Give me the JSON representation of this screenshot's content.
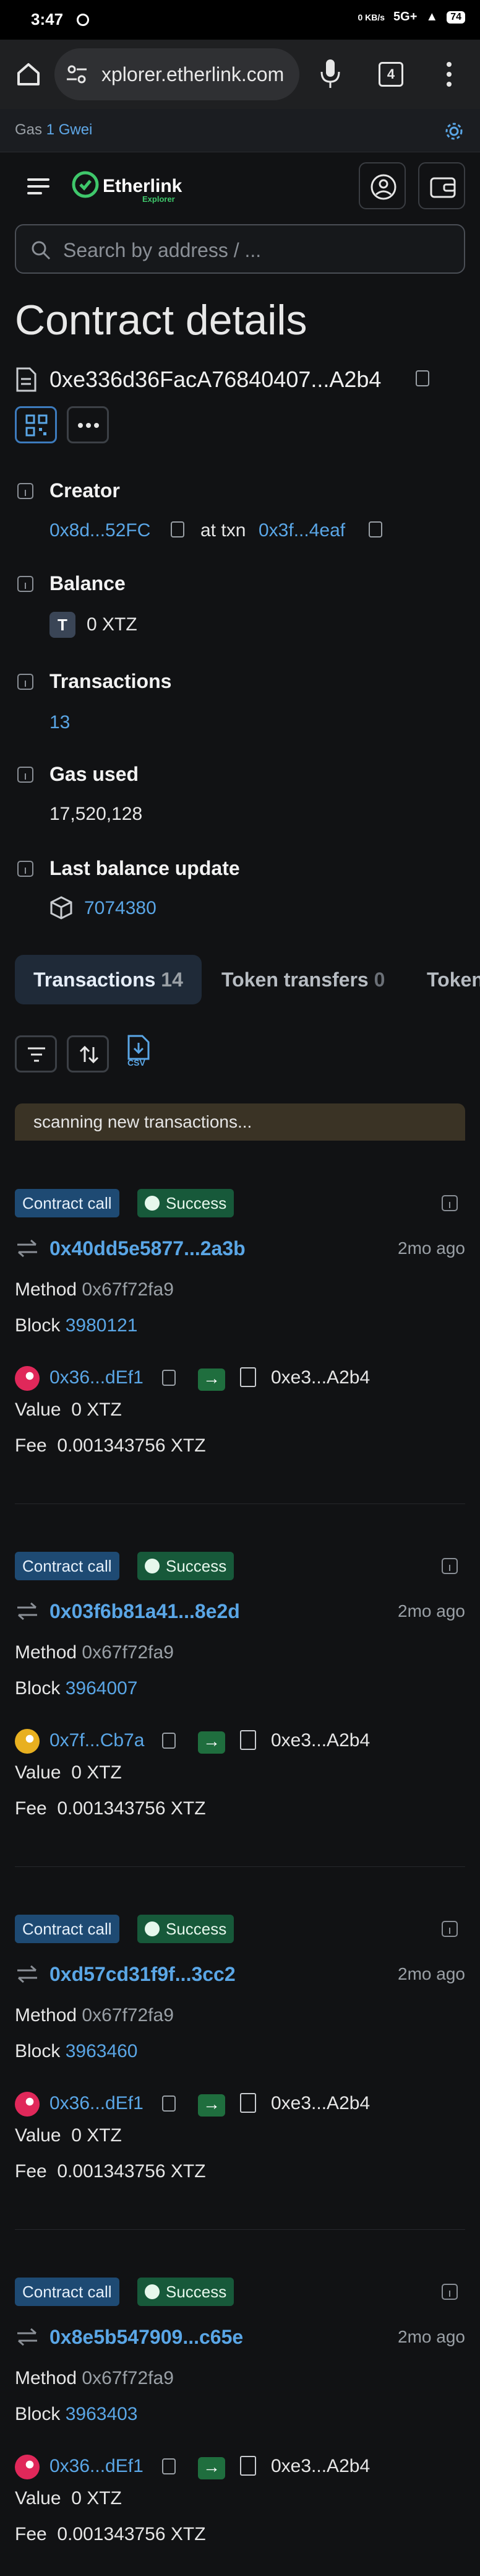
{
  "status_bar": {
    "time": "3:47",
    "net_speed": "0 KB/s",
    "signal": "5G+",
    "battery": "74"
  },
  "browser": {
    "url": "xplorer.etherlink.com",
    "tab_count": "4"
  },
  "gas": {
    "label": "Gas",
    "value": "1 Gwei"
  },
  "header": {
    "logo": "Etherlink",
    "logo_sub": "Explorer"
  },
  "search": {
    "placeholder": "Search by address / ..."
  },
  "page": {
    "title": "Contract details",
    "address": "0xe336d36FacA76840407...A2b4"
  },
  "details": {
    "creator": {
      "label": "Creator",
      "address": "0x8d...52FC",
      "at_txn": "at txn",
      "txn": "0x3f...4eaf"
    },
    "balance": {
      "label": "Balance",
      "token_letter": "T",
      "value": "0 XTZ"
    },
    "transactions": {
      "label": "Transactions",
      "value": "13"
    },
    "gas_used": {
      "label": "Gas used",
      "value": "17,520,128"
    },
    "last_balance_update": {
      "label": "Last balance update",
      "value": "7074380"
    }
  },
  "tabs": [
    {
      "label": "Transactions",
      "count": "14"
    },
    {
      "label": "Token transfers",
      "count": "0"
    },
    {
      "label": "Token"
    }
  ],
  "toolbar": {
    "csv_label": "CSV"
  },
  "scanning_text": "scanning new transactions...",
  "txs": [
    {
      "type": "Contract call",
      "status": "Success",
      "hash": "0x40dd5e5877...2a3b",
      "age": "2mo ago",
      "method_label": "Method",
      "method": "0x67f72fa9",
      "block_label": "Block",
      "block": "3980121",
      "from": "0x36...dEf1",
      "to": "0xe3...A2b4",
      "value_label": "Value",
      "value": "0 XTZ",
      "fee_label": "Fee",
      "fee": "0.001343756 XTZ",
      "avatar_color": "#e0285a"
    },
    {
      "type": "Contract call",
      "status": "Success",
      "hash": "0x03f6b81a41...8e2d",
      "age": "2mo ago",
      "method_label": "Method",
      "method": "0x67f72fa9",
      "block_label": "Block",
      "block": "3964007",
      "from": "0x7f...Cb7a",
      "to": "0xe3...A2b4",
      "value_label": "Value",
      "value": "0 XTZ",
      "fee_label": "Fee",
      "fee": "0.001343756 XTZ",
      "avatar_color": "#e8b020"
    },
    {
      "type": "Contract call",
      "status": "Success",
      "hash": "0xd57cd31f9f...3cc2",
      "age": "2mo ago",
      "method_label": "Method",
      "method": "0x67f72fa9",
      "block_label": "Block",
      "block": "3963460",
      "from": "0x36...dEf1",
      "to": "0xe3...A2b4",
      "value_label": "Value",
      "value": "0 XTZ",
      "fee_label": "Fee",
      "fee": "0.001343756 XTZ",
      "avatar_color": "#e0285a"
    },
    {
      "type": "Contract call",
      "status": "Success",
      "hash": "0x8e5b547909...c65e",
      "age": "2mo ago",
      "method_label": "Method",
      "method": "0x67f72fa9",
      "block_label": "Block",
      "block": "3963403",
      "from": "0x36...dEf1",
      "to": "0xe3...A2b4",
      "value_label": "Value",
      "value": "0 XTZ",
      "fee_label": "Fee",
      "fee": "0.001343756 XTZ",
      "avatar_color": "#e0285a"
    }
  ]
}
